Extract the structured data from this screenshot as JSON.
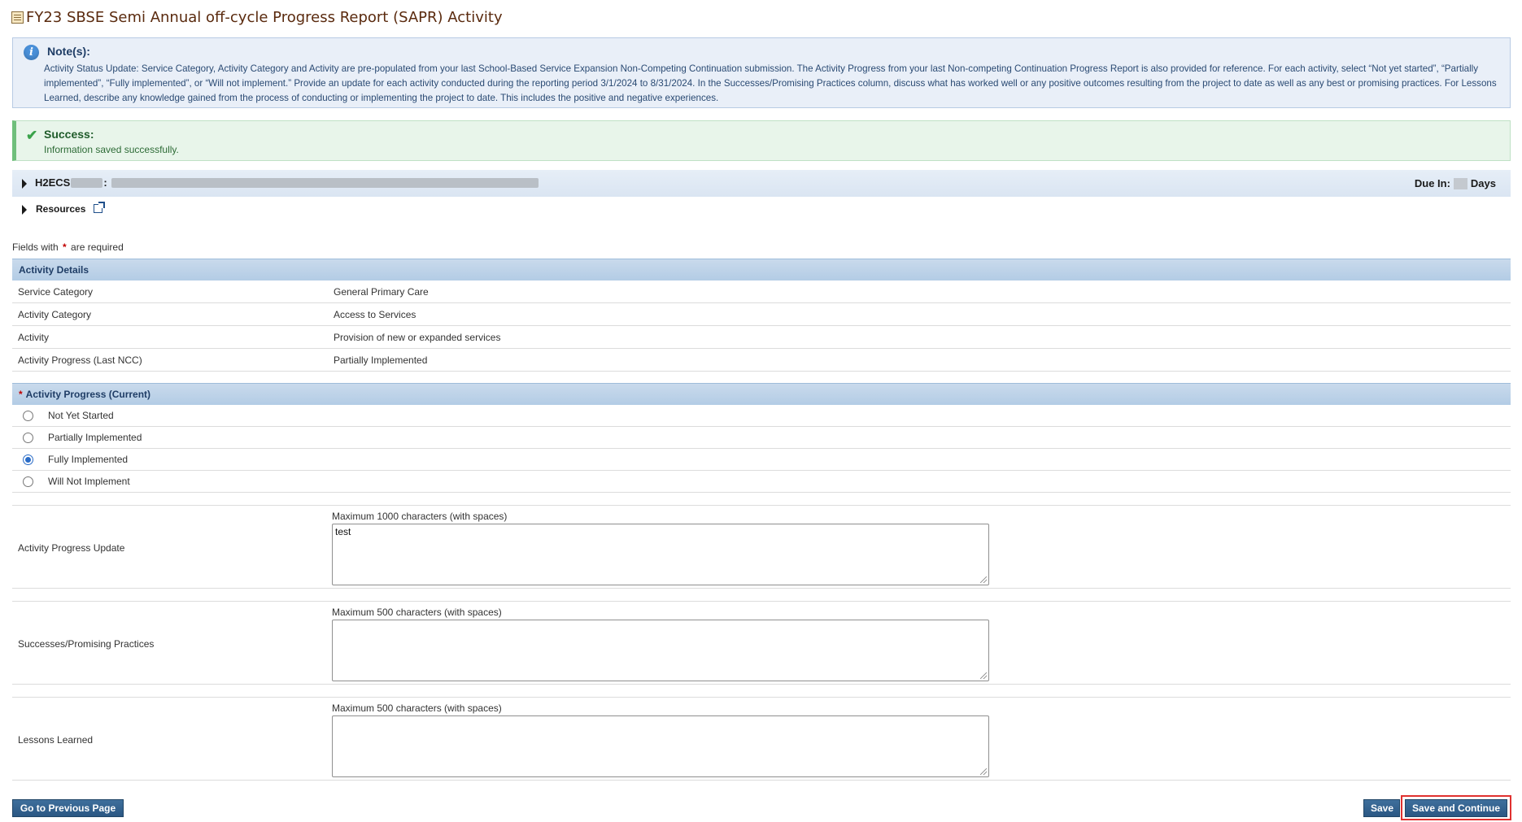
{
  "page": {
    "title": "FY23 SBSE Semi Annual off-cycle Progress Report (SAPR) Activity"
  },
  "note": {
    "heading": "Note(s):",
    "body": "Activity Status Update: Service Category, Activity Category and Activity are pre-populated from your last School-Based Service Expansion Non-Competing Continuation submission. The Activity Progress from your last Non-competing Continuation Progress Report is also provided for reference. For each activity, select “Not yet started”, “Partially implemented”, “Fully implemented”, or “Will not implement.” Provide an update for each activity conducted during the reporting period 3/1/2024 to 8/31/2024. In the Successes/Promising Practices column, discuss what has worked well or any positive outcomes resulting from the project to date as well as any best or promising practices. For Lessons Learned, describe any knowledge gained from the process of conducting or implementing the project to date. This includes the positive and negative experiences."
  },
  "success": {
    "heading": "Success:",
    "body": "Information saved successfully."
  },
  "grant": {
    "prefix": "H2ECS",
    "separator": ":",
    "due_label": "Due In:",
    "days_label": "Days"
  },
  "resources": {
    "label": "Resources"
  },
  "required_note": {
    "before": "Fields with",
    "star": "*",
    "after": "are required"
  },
  "activity_details": {
    "heading": "Activity Details",
    "rows": [
      {
        "label": "Service Category",
        "value": "General Primary Care"
      },
      {
        "label": "Activity Category",
        "value": "Access to Services"
      },
      {
        "label": "Activity",
        "value": "Provision of new or expanded services"
      },
      {
        "label": "Activity Progress (Last NCC)",
        "value": "Partially Implemented"
      }
    ]
  },
  "activity_progress": {
    "star": "*",
    "heading": "Activity Progress (Current)",
    "options": [
      {
        "label": "Not Yet Started",
        "selected": false
      },
      {
        "label": "Partially Implemented",
        "selected": false
      },
      {
        "label": "Fully Implemented",
        "selected": true
      },
      {
        "label": "Will Not Implement",
        "selected": false
      }
    ]
  },
  "fields": {
    "progress_update": {
      "label": "Activity Progress Update",
      "max": "Maximum 1000 characters (with spaces)",
      "value": "test"
    },
    "successes": {
      "label": "Successes/Promising Practices",
      "max": "Maximum 500 characters (with spaces)",
      "value": ""
    },
    "lessons": {
      "label": "Lessons Learned",
      "max": "Maximum 500 characters (with spaces)",
      "value": ""
    }
  },
  "buttons": {
    "previous": "Go to Previous Page",
    "save": "Save",
    "save_continue": "Save and Continue"
  },
  "colors": {
    "title": "#5a2a0e",
    "section_header": "#b3cce5",
    "button": "#2b5783",
    "highlight": "#e0312f",
    "success_accent": "#6fbf7b"
  }
}
